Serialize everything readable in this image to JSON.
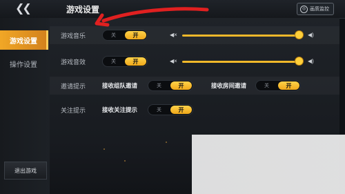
{
  "header": {
    "back_icon": "double-chevron-left-icon",
    "title": "游戏设置",
    "quality_button": {
      "label": "画质监控",
      "icon": "quality-icon"
    }
  },
  "sidebar": {
    "items": [
      {
        "label": "游戏设置",
        "active": true
      },
      {
        "label": "操作设置",
        "active": false
      }
    ],
    "exit_label": "退出游戏"
  },
  "settings": {
    "music": {
      "label": "游戏音乐",
      "off": "关",
      "on": "开",
      "volume": 0.95
    },
    "sfx": {
      "label": "游戏音效",
      "off": "关",
      "on": "开",
      "volume": 0.95
    },
    "invite": {
      "label": "邀请提示",
      "team": {
        "label": "接收组队邀请",
        "off": "关",
        "on": "开"
      },
      "room": {
        "label": "接收房间邀请",
        "off": "关",
        "on": "开"
      }
    },
    "follow": {
      "label": "关注提示",
      "follow_notice": {
        "label": "接收关注提示",
        "off": "关",
        "on": "开"
      }
    }
  },
  "colors": {
    "accent": "#f0a81a",
    "annotation": "#e02020",
    "background": "#0f1216"
  }
}
